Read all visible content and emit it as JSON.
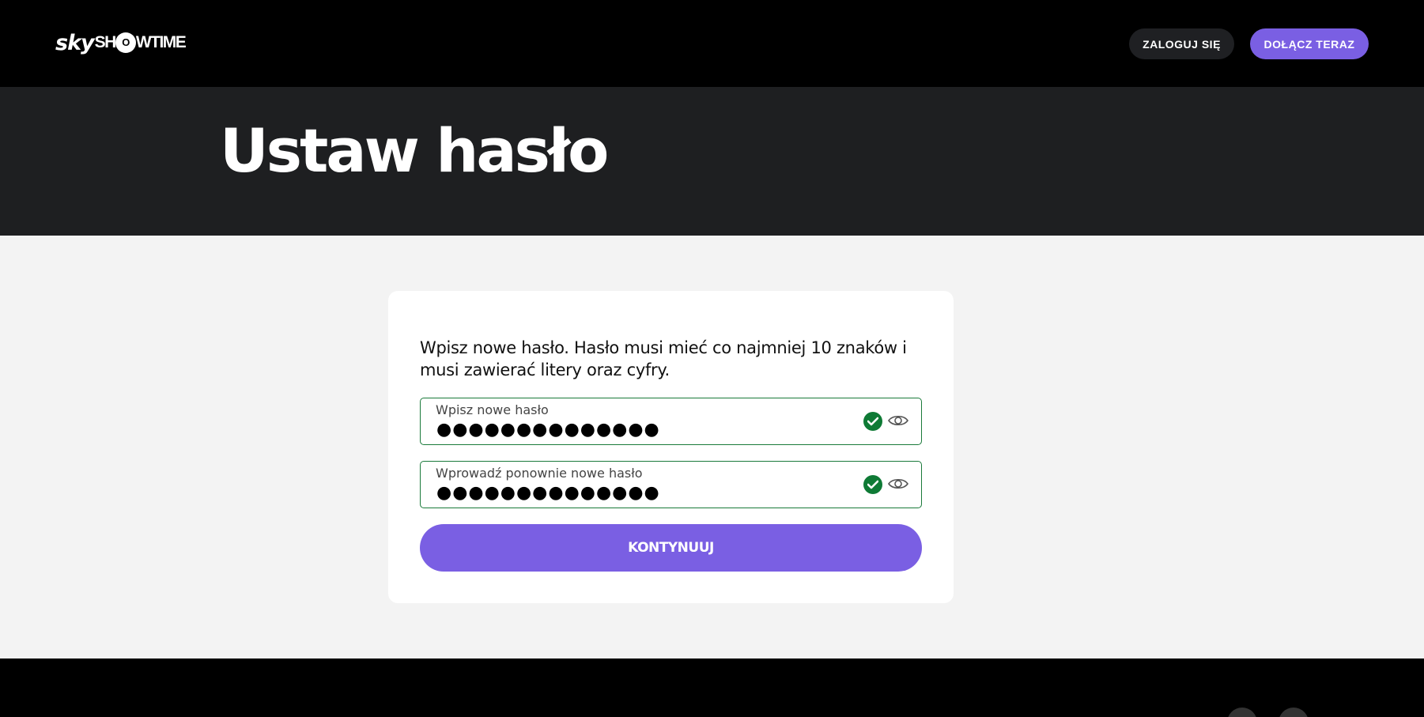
{
  "header": {
    "logo_sky": "sky",
    "logo_show_a": "SH",
    "logo_show_ring": "O",
    "logo_time": "WTIME",
    "login_label": "ZALOGUJ SIĘ",
    "join_label": "DOŁĄCZ TERAZ"
  },
  "hero": {
    "title": "Ustaw hasło"
  },
  "form": {
    "intro": "Wpisz nowe hasło. Hasło musi mieć co najmniej 10 znaków i musi zawierać litery oraz cyfry.",
    "password": {
      "label": "Wpisz nowe hasło",
      "masked_value": "●●●●●●●●●●●●●●"
    },
    "confirm": {
      "label": "Wprowadź ponownie nowe hasło",
      "masked_value": "●●●●●●●●●●●●●●"
    },
    "submit_label": "KONTYNUUJ"
  },
  "footer": {
    "social_icons": [
      "facebook-icon",
      "youtube-icon"
    ]
  },
  "colors": {
    "accent": "#7a5fe3",
    "valid_green": "#0e7a35",
    "header_bg": "#000000",
    "hero_bg": "#1e1f21",
    "page_bg": "#f3f3f3"
  }
}
